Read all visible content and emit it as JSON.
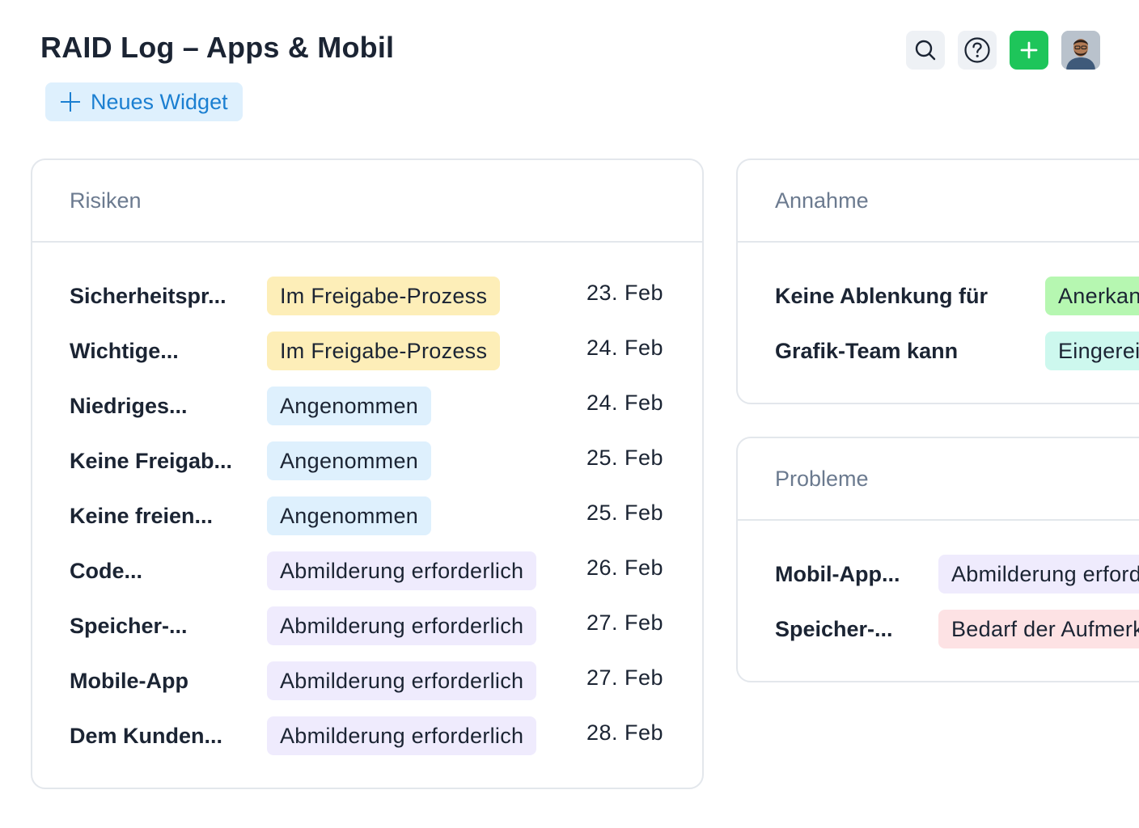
{
  "header": {
    "title": "RAID Log – Apps & Mobil",
    "new_widget_label": "Neues Widget"
  },
  "toolbar": {
    "icons": [
      "search-icon",
      "help-icon",
      "plus-icon",
      "user-avatar"
    ]
  },
  "colors": {
    "yellow_badge": "#fdeeb8",
    "blue_badge": "#def0fd",
    "purple_badge": "#efebfd",
    "green_badge": "#b6f7b1",
    "teal_badge": "#cdf8ee",
    "red_badge": "#fde2e4",
    "add_button": "#1ec55a",
    "accent": "#1b7fd1"
  },
  "risks": {
    "title": "Risiken",
    "rows": [
      {
        "name": "Sicherheitspr...",
        "status": "Im Freigabe-Prozess",
        "date": "23. Feb"
      },
      {
        "name": "Wichtige...",
        "status": "Im Freigabe-Prozess",
        "date": "24. Feb"
      },
      {
        "name": "Niedriges...",
        "status": "Angenommen",
        "date": "24. Feb"
      },
      {
        "name": "Keine Freigab...",
        "status": "Angenommen",
        "date": "25. Feb"
      },
      {
        "name": "Keine freien...",
        "status": "Angenommen",
        "date": "25. Feb"
      },
      {
        "name": "Code...",
        "status": "Abmilderung erforderlich",
        "date": "26. Feb"
      },
      {
        "name": "Speicher-...",
        "status": "Abmilderung erforderlich",
        "date": "27. Feb"
      },
      {
        "name": "Mobile-App",
        "status": "Abmilderung erforderlich",
        "date": "27. Feb"
      },
      {
        "name": "Dem Kunden...",
        "status": "Abmilderung erforderlich",
        "date": "28. Feb"
      }
    ]
  },
  "assumptions": {
    "title": "Annahme",
    "rows": [
      {
        "name": "Keine Ablenkung für",
        "status": "Anerkannt"
      },
      {
        "name": "Grafik-Team kann",
        "status": "Eingereicht"
      }
    ]
  },
  "issues": {
    "title": "Probleme",
    "rows": [
      {
        "name": "Mobil-App...",
        "status": "Abmilderung erforderlich"
      },
      {
        "name": "Speicher-...",
        "status": "Bedarf der Aufmerksamkeit"
      }
    ]
  }
}
